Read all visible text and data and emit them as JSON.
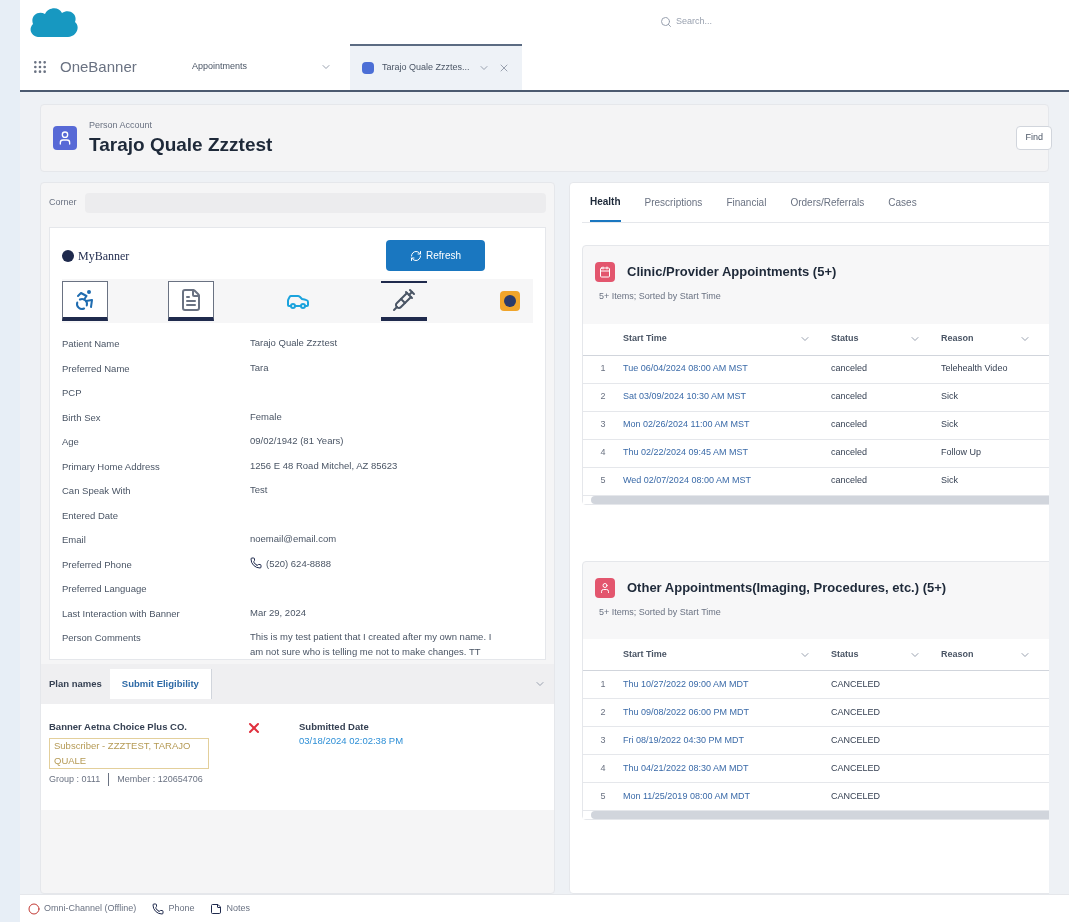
{
  "search": {
    "placeholder": "Search..."
  },
  "app": {
    "name": "OneBanner"
  },
  "nav_tabs": [
    {
      "label": "Appointments",
      "kind": "menu",
      "selected": false
    },
    {
      "label": "Tarajo Quale Zzztes...",
      "kind": "record",
      "selected": true
    }
  ],
  "record": {
    "type": "Person Account",
    "name": "Tarajo Quale Zzztest",
    "action": "Find"
  },
  "left_panel": {
    "corner_label": "Corner",
    "brand": "MyBanner",
    "refresh": "Refresh",
    "fields": [
      {
        "label": "Patient Name",
        "value": "Tarajo Quale Zzztest"
      },
      {
        "label": "Preferred Name",
        "value": "Tara"
      },
      {
        "label": "PCP"
      },
      {
        "label": "Birth Sex",
        "value": "Female"
      },
      {
        "label": "Age",
        "value": "09/02/1942 (81 Years)"
      },
      {
        "label": "Primary Home Address",
        "value": "1256 E 48 Road Mitchel, AZ 85623"
      },
      {
        "label": "Can Speak With",
        "value": "Test"
      },
      {
        "label": "Entered Date"
      },
      {
        "label": "Email",
        "value": "noemail@email.com"
      },
      {
        "label": "Preferred Phone",
        "value": "(520) 624-8888",
        "kind": "phone"
      },
      {
        "label": "Preferred Language"
      },
      {
        "label": "Last Interaction with Banner",
        "value": "Mar 29, 2024"
      },
      {
        "label": "Person Comments",
        "value": "This is my test patient that I created after my own name. I am not sure who is telling me not to make changes. TT"
      }
    ],
    "plan": {
      "label": "Plan names",
      "submit": "Submit Eligibility",
      "name": "Banner Aetna Choice Plus CO.",
      "subscriber": "Subscriber - ZZZTEST, TARAJO QUALE",
      "eligible": false,
      "submitted_label": "Submitted Date",
      "submitted_date": "03/18/2024 02:02:38 PM",
      "group": "Group : 0111",
      "member": "Member : 120654706"
    }
  },
  "right_tabs": [
    {
      "label": "Health",
      "selected": true
    },
    {
      "label": "Prescriptions",
      "selected": false
    },
    {
      "label": "Financial",
      "selected": false
    },
    {
      "label": "Orders/Referrals",
      "selected": false
    },
    {
      "label": "Cases",
      "selected": false
    }
  ],
  "lists": [
    {
      "title": "Clinic/Provider Appointments (5+)",
      "subtitle": "5+ Items; Sorted by Start Time",
      "kind": "clinic",
      "columns": [
        "",
        "Start Time",
        "Status",
        "Reason"
      ],
      "rows": [
        [
          "1",
          "Tue 06/04/2024 08:00 AM MST",
          "canceled",
          "Telehealth Video"
        ],
        [
          "2",
          "Sat 03/09/2024 10:30 AM MST",
          "canceled",
          "Sick"
        ],
        [
          "3",
          "Mon 02/26/2024 11:00 AM MST",
          "canceled",
          "Sick"
        ],
        [
          "4",
          "Thu 02/22/2024 09:45 AM MST",
          "canceled",
          "Follow Up"
        ],
        [
          "5",
          "Wed 02/07/2024 08:00 AM MST",
          "canceled",
          "Sick"
        ]
      ]
    },
    {
      "title": "Other Appointments(Imaging, Procedures, etc.) (5+)",
      "subtitle": "5+ Items; Sorted by Start Time",
      "kind": "other",
      "columns": [
        "",
        "Start Time",
        "Status",
        "Reason"
      ],
      "rows": [
        [
          "1",
          "Thu 10/27/2022 09:00 AM MDT",
          "CANCELED"
        ],
        [
          "2",
          "Thu 09/08/2022 06:00 PM MDT",
          "CANCELED"
        ],
        [
          "3",
          "Fri 08/19/2022 04:30 PM MDT",
          "CANCELED"
        ],
        [
          "4",
          "Thu 04/21/2022 08:30 AM MDT",
          "CANCELED"
        ],
        [
          "5",
          "Mon 11/25/2019 08:00 AM MDT",
          "CANCELED"
        ]
      ]
    }
  ],
  "footer": [
    {
      "label": "Omni-Channel (Offline)",
      "kind": "status"
    },
    {
      "label": "Phone",
      "kind": "phone"
    },
    {
      "label": "Notes",
      "kind": "notes"
    }
  ]
}
